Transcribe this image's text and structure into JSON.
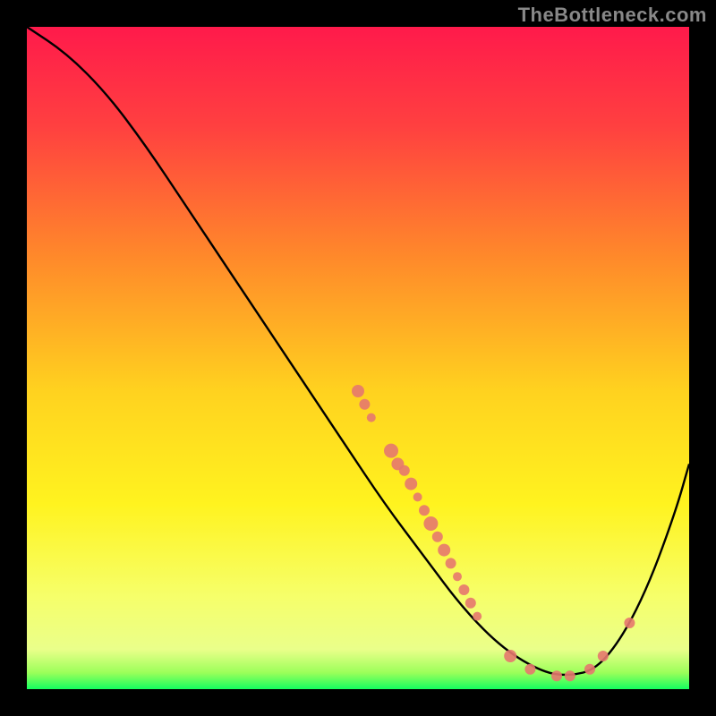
{
  "attribution": "TheBottleneck.com",
  "colors": {
    "marker_fill": "#e6786e",
    "marker_stroke": "#e6786e",
    "curve_stroke": "#000000"
  },
  "chart_data": {
    "type": "line",
    "title": "",
    "xlabel": "",
    "ylabel": "",
    "xlim": [
      0,
      100
    ],
    "ylim": [
      0,
      100
    ],
    "curve": [
      {
        "x": 0,
        "y": 100
      },
      {
        "x": 6,
        "y": 96
      },
      {
        "x": 12,
        "y": 90
      },
      {
        "x": 18,
        "y": 82
      },
      {
        "x": 24,
        "y": 73
      },
      {
        "x": 30,
        "y": 64
      },
      {
        "x": 36,
        "y": 55
      },
      {
        "x": 42,
        "y": 46
      },
      {
        "x": 48,
        "y": 37
      },
      {
        "x": 54,
        "y": 28
      },
      {
        "x": 60,
        "y": 20
      },
      {
        "x": 66,
        "y": 12
      },
      {
        "x": 72,
        "y": 6
      },
      {
        "x": 78,
        "y": 2.5
      },
      {
        "x": 82,
        "y": 2
      },
      {
        "x": 86,
        "y": 3
      },
      {
        "x": 90,
        "y": 8
      },
      {
        "x": 94,
        "y": 16
      },
      {
        "x": 98,
        "y": 27
      },
      {
        "x": 100,
        "y": 34
      }
    ],
    "points": [
      {
        "x": 50,
        "y": 45,
        "r": 7
      },
      {
        "x": 51,
        "y": 43,
        "r": 6
      },
      {
        "x": 52,
        "y": 41,
        "r": 5
      },
      {
        "x": 55,
        "y": 36,
        "r": 8
      },
      {
        "x": 56,
        "y": 34,
        "r": 7
      },
      {
        "x": 57,
        "y": 33,
        "r": 6
      },
      {
        "x": 58,
        "y": 31,
        "r": 7
      },
      {
        "x": 59,
        "y": 29,
        "r": 5
      },
      {
        "x": 60,
        "y": 27,
        "r": 6
      },
      {
        "x": 61,
        "y": 25,
        "r": 8
      },
      {
        "x": 62,
        "y": 23,
        "r": 6
      },
      {
        "x": 63,
        "y": 21,
        "r": 7
      },
      {
        "x": 64,
        "y": 19,
        "r": 6
      },
      {
        "x": 65,
        "y": 17,
        "r": 5
      },
      {
        "x": 66,
        "y": 15,
        "r": 6
      },
      {
        "x": 67,
        "y": 13,
        "r": 6
      },
      {
        "x": 68,
        "y": 11,
        "r": 5
      },
      {
        "x": 73,
        "y": 5,
        "r": 7
      },
      {
        "x": 76,
        "y": 3,
        "r": 6
      },
      {
        "x": 80,
        "y": 2,
        "r": 6
      },
      {
        "x": 82,
        "y": 2,
        "r": 6
      },
      {
        "x": 85,
        "y": 3,
        "r": 6
      },
      {
        "x": 87,
        "y": 5,
        "r": 6
      },
      {
        "x": 91,
        "y": 10,
        "r": 6
      }
    ]
  }
}
